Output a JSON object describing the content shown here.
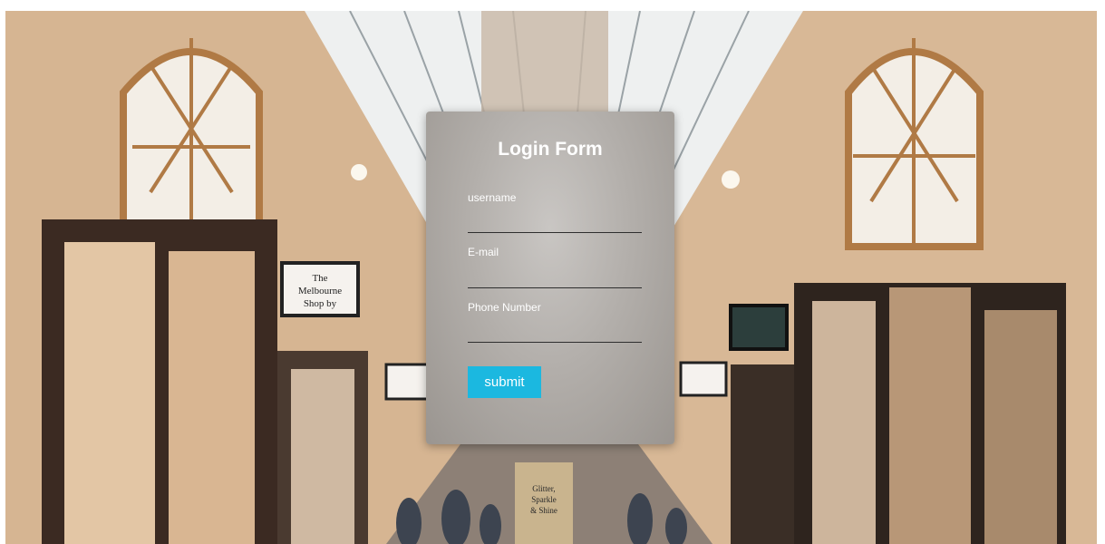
{
  "form": {
    "title": "Login Form",
    "fields": [
      {
        "label": "username",
        "value": ""
      },
      {
        "label": "E-mail",
        "value": ""
      },
      {
        "label": "Phone Number",
        "value": ""
      }
    ],
    "submit_label": "submit",
    "accent_color": "#1bb8e0"
  },
  "background": {
    "scene": "shopping-arcade-photo",
    "signs": [
      {
        "text": "The Melbourne Shop by"
      },
      {
        "text": "Glitter, Sparkle & Shine"
      }
    ]
  }
}
